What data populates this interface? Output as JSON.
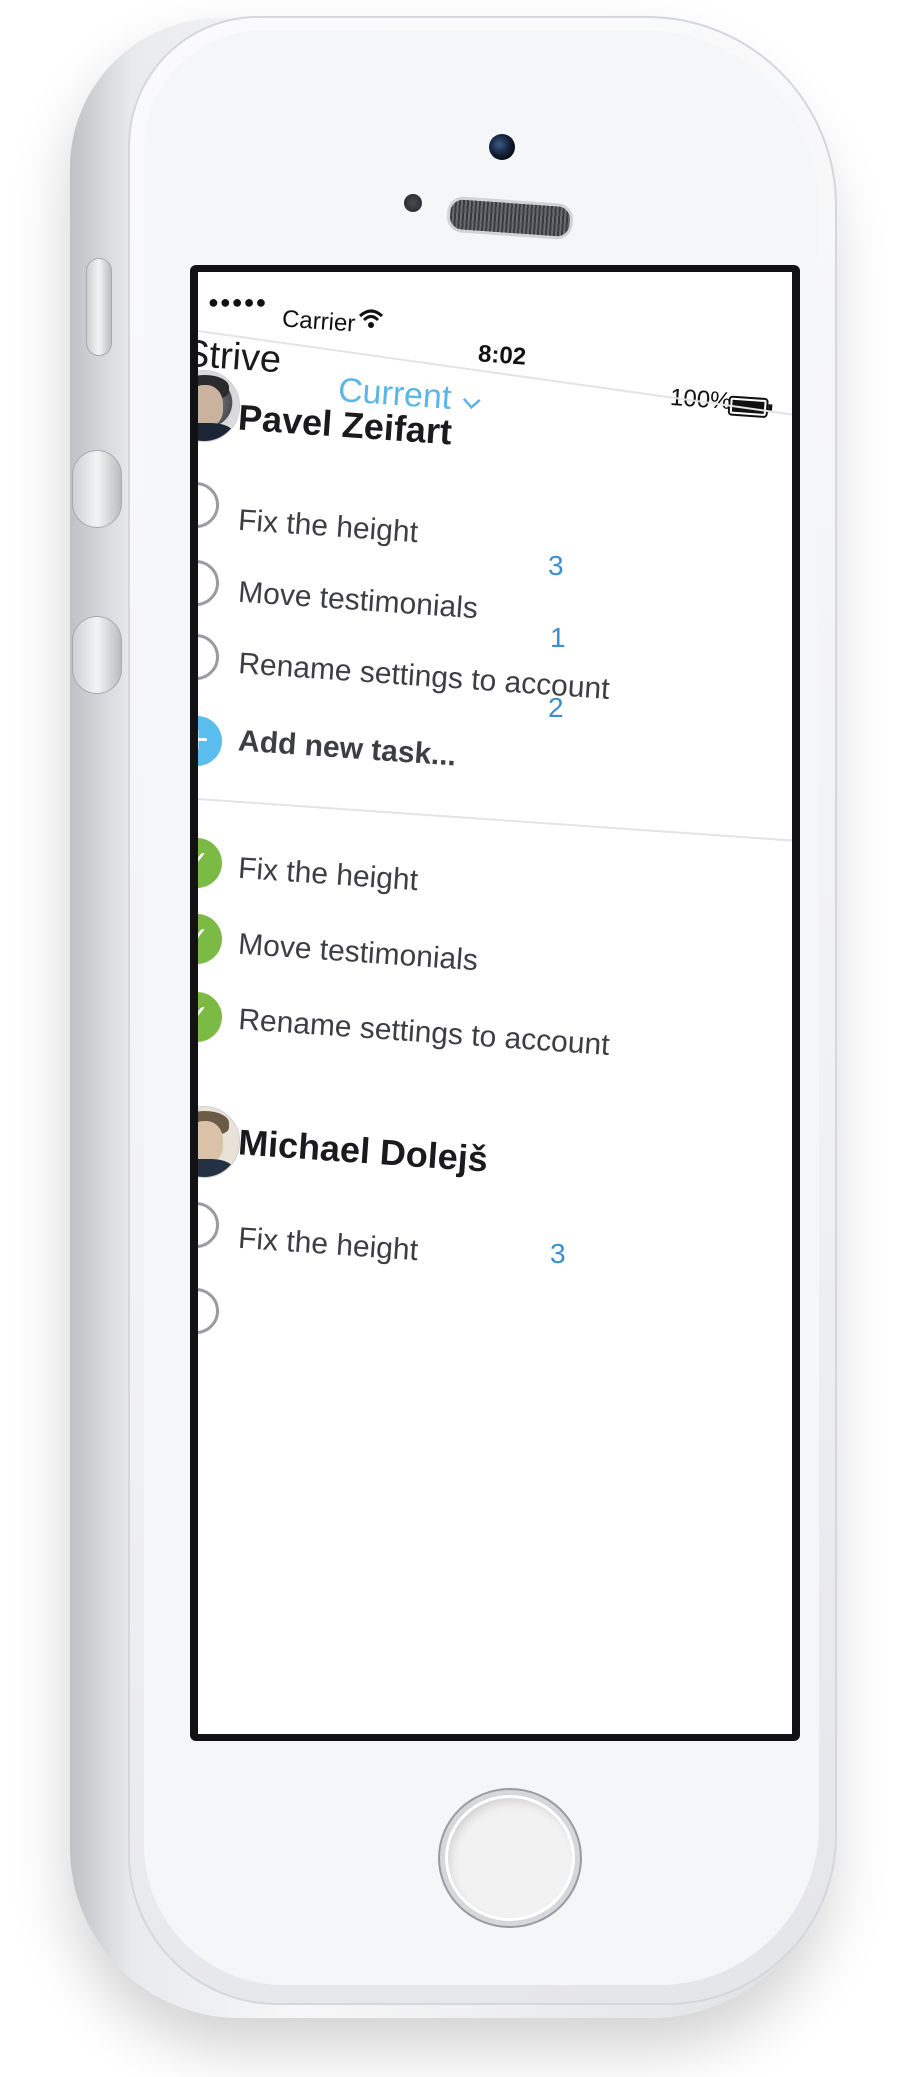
{
  "status_bar": {
    "signal": "●●●●●",
    "carrier": "Carrier",
    "time": "8:02",
    "battery_percent": "100%"
  },
  "nav": {
    "back_label": "Strive",
    "title": "Current"
  },
  "sections": [
    {
      "user": "Pavel Zeifart",
      "open_tasks": [
        {
          "label": "Fix the height",
          "count": "3"
        },
        {
          "label": "Move testimonials",
          "count": "1"
        },
        {
          "label": "Rename settings to account",
          "count": "2"
        }
      ],
      "add_task_label": "Add new task...",
      "done_tasks": [
        {
          "label": "Fix the height"
        },
        {
          "label": "Move testimonials"
        },
        {
          "label": "Rename settings to account"
        }
      ]
    },
    {
      "user": "Michael Dolejš",
      "open_tasks": [
        {
          "label": "Fix the height",
          "count": "3"
        }
      ]
    }
  ],
  "colors": {
    "accent_blue": "#5bb6e6",
    "done_green": "#7cba46",
    "count_blue": "#3b8fcf"
  },
  "icons": {
    "back": "chevron-left-icon",
    "dropdown": "chevron-down-icon",
    "wifi": "wifi-icon",
    "battery": "battery-icon",
    "add": "plus-icon",
    "done": "checkmark-icon"
  }
}
